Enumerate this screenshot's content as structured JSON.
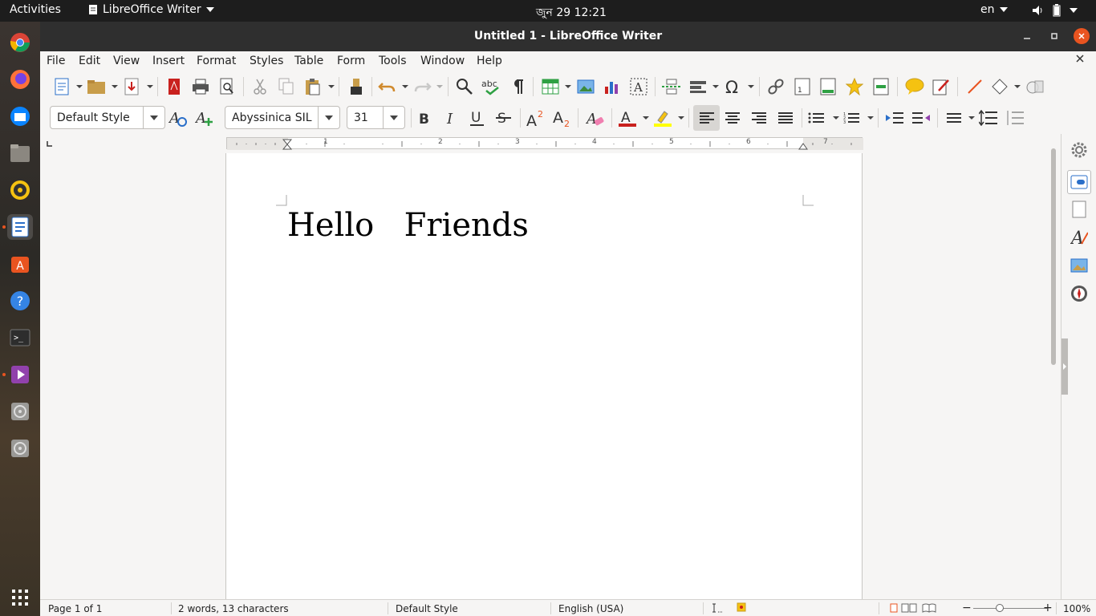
{
  "topbar": {
    "activities": "Activities",
    "app_name": "LibreOffice Writer",
    "clock": "জুন 29  12:21",
    "lang": "en"
  },
  "dock": {
    "items": [
      "chrome-icon",
      "firefox-icon",
      "thunderbird-icon",
      "files-icon",
      "rhythmbox-icon",
      "writer-icon",
      "software-icon",
      "help-icon",
      "terminal-icon",
      "media-icon",
      "disc-icon",
      "disc-icon",
      "apps-grid-icon"
    ]
  },
  "window": {
    "title": "Untitled 1 - LibreOffice Writer"
  },
  "menu": {
    "file": "File",
    "edit": "Edit",
    "view": "View",
    "insert": "Insert",
    "format": "Format",
    "styles": "Styles",
    "table": "Table",
    "form": "Form",
    "tools": "Tools",
    "window": "Window",
    "help": "Help"
  },
  "format_bar": {
    "paragraph_style": "Default Style",
    "font_name": "Abyssinica SIL",
    "font_size": "31"
  },
  "ruler": {
    "labels": [
      "1",
      "1",
      "2",
      "3",
      "4",
      "5",
      "6",
      "7"
    ]
  },
  "document": {
    "text": "Hello  Friends"
  },
  "statusbar": {
    "page": "Page 1 of 1",
    "words": "2 words, 13 characters",
    "style": "Default Style",
    "language": "English (USA)",
    "zoom": "100%"
  },
  "colors": {
    "accent": "#e95420",
    "font_color": "#c9211e",
    "highlight": "#ffff00"
  }
}
